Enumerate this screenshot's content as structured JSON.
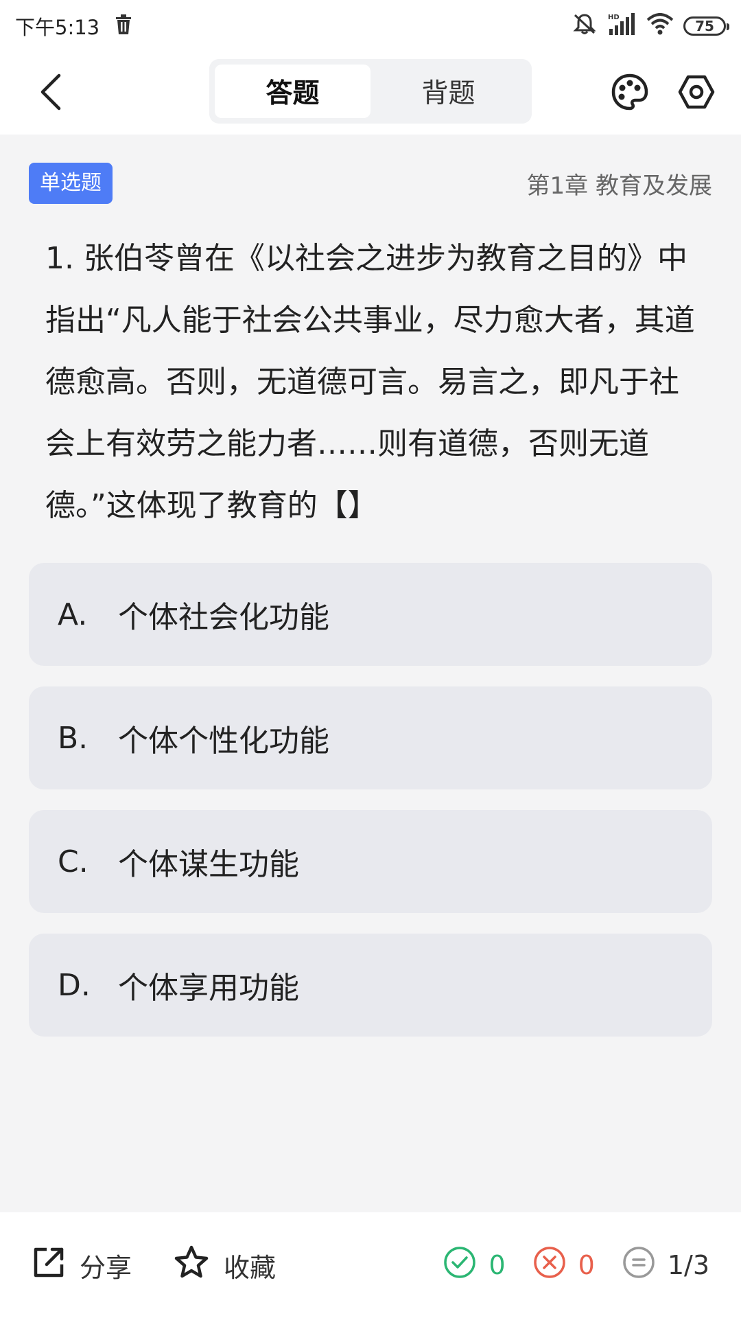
{
  "status_bar": {
    "time": "下午5:13",
    "battery": "75"
  },
  "header": {
    "tabs": [
      {
        "label": "答题",
        "active": true
      },
      {
        "label": "背题",
        "active": false
      }
    ]
  },
  "question": {
    "type_badge": "单选题",
    "chapter": "第1章 教育及发展",
    "text": "1. 张伯苓曾在《以社会之进步为教育之目的》中指出“凡人能于社会公共事业，尽力愈大者，其道德愈高。否则，无道德可言。易言之，即凡于社会上有效劳之能力者……则有道德，否则无道德。”这体现了教育的【】",
    "options": [
      {
        "letter": "A.",
        "text": "个体社会化功能"
      },
      {
        "letter": "B.",
        "text": "个体个性化功能"
      },
      {
        "letter": "C.",
        "text": "个体谋生功能"
      },
      {
        "letter": "D.",
        "text": "个体享用功能"
      }
    ]
  },
  "bottom_bar": {
    "share_label": "分享",
    "favorite_label": "收藏",
    "correct_count": "0",
    "wrong_count": "0",
    "progress": "1/3"
  },
  "colors": {
    "accent": "#4e7cf6",
    "correct": "#2bb673",
    "wrong": "#e8604c"
  }
}
